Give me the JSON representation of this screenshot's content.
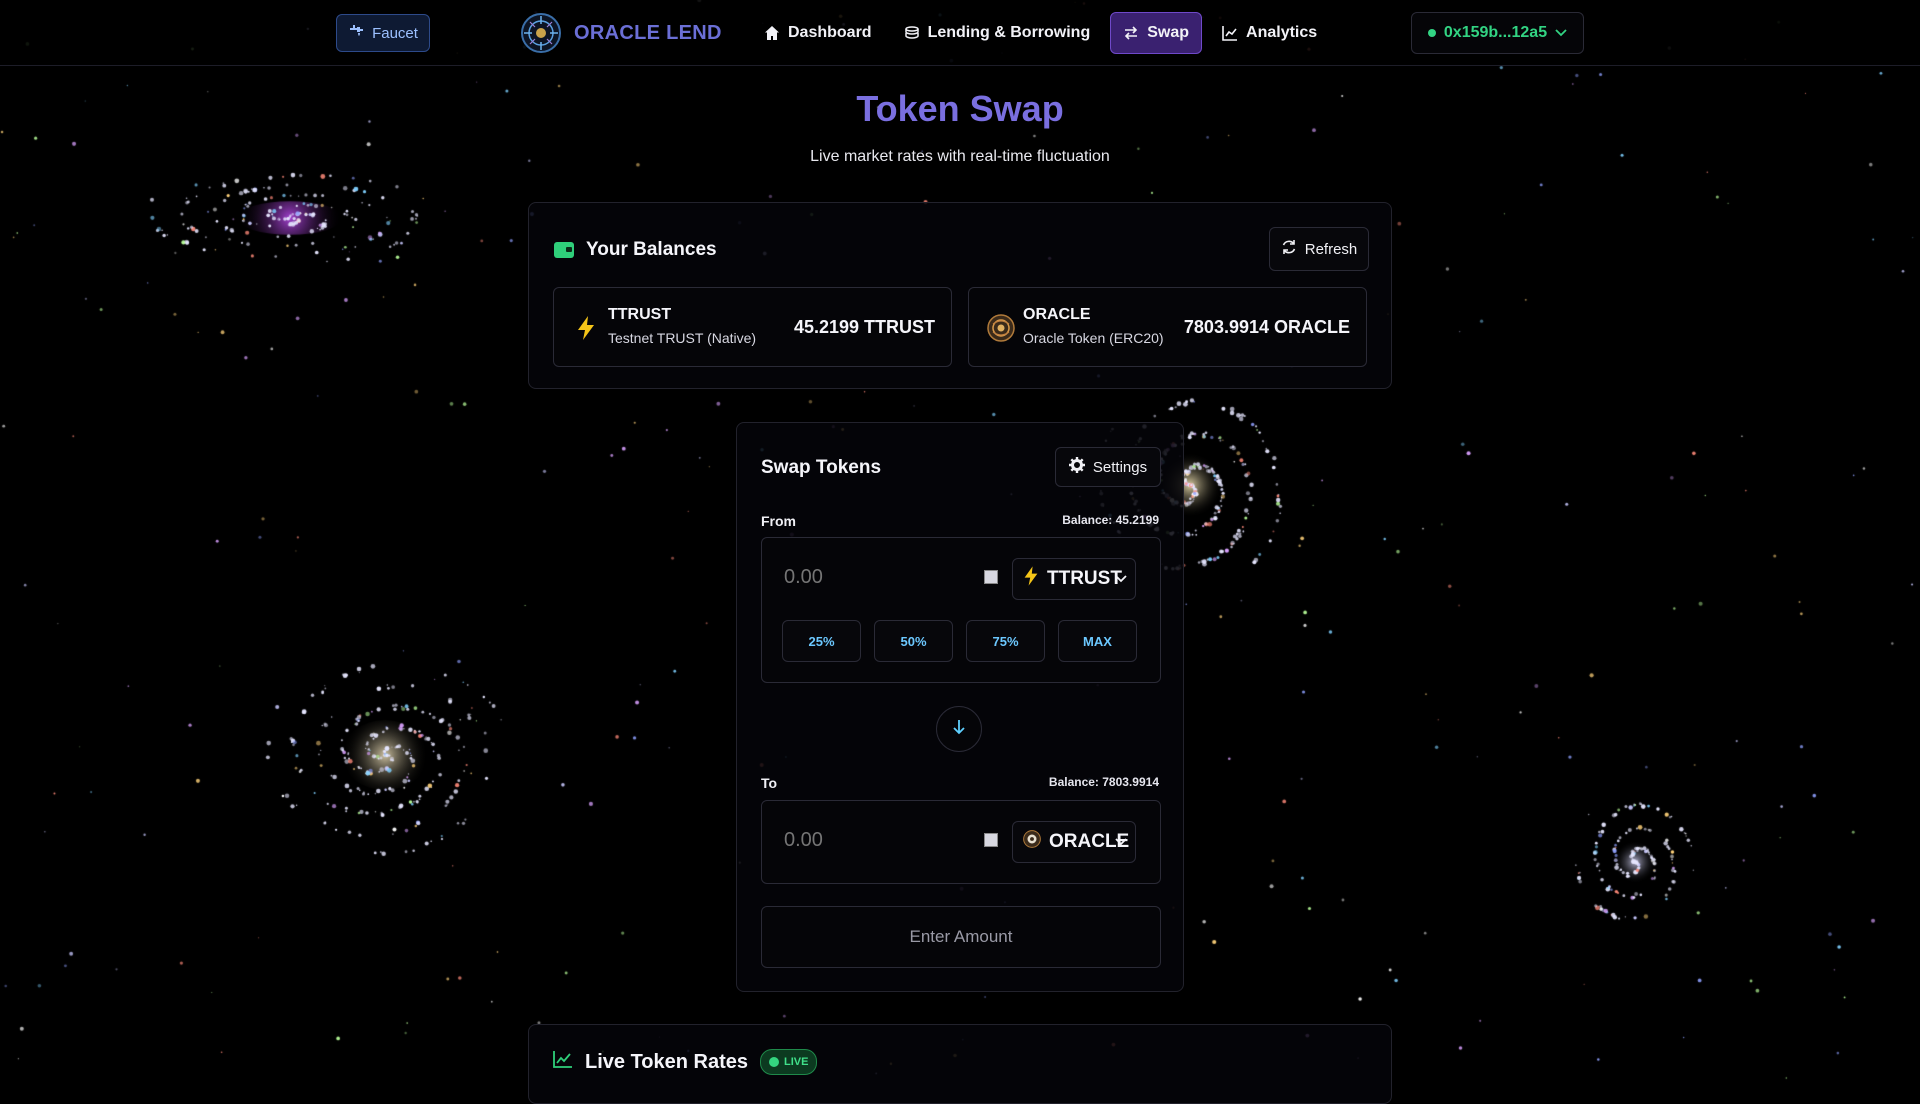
{
  "nav": {
    "faucet_label": "Faucet",
    "brand_name": "ORACLE LEND",
    "items": [
      {
        "label": "Dashboard",
        "icon": "home-icon",
        "active": false
      },
      {
        "label": "Lending & Borrowing",
        "icon": "coins-icon",
        "active": false
      },
      {
        "label": "Swap",
        "icon": "swap-icon",
        "active": true
      },
      {
        "label": "Analytics",
        "icon": "chart-icon",
        "active": false
      }
    ],
    "wallet_address": "0x159b...12a5"
  },
  "page": {
    "title": "Token Swap",
    "subtitle": "Live market rates with real-time fluctuation"
  },
  "balances": {
    "title": "Your Balances",
    "refresh_label": "Refresh",
    "tokens": [
      {
        "symbol": "TTRUST",
        "name": "Testnet TRUST (Native)",
        "amount": "45.2199 TTRUST",
        "icon": "lightning-icon"
      },
      {
        "symbol": "ORACLE",
        "name": "Oracle Token (ERC20)",
        "amount": "7803.9914 ORACLE",
        "icon": "oracle-token-icon"
      }
    ]
  },
  "swap": {
    "title": "Swap Tokens",
    "settings_label": "Settings",
    "from": {
      "label": "From",
      "balance": "Balance: 45.2199",
      "placeholder": "0.00",
      "token": "TTRUST"
    },
    "to": {
      "label": "To",
      "balance": "Balance: 7803.9914",
      "placeholder": "0.00",
      "token": "ORACLE"
    },
    "percent_buttons": [
      "25%",
      "50%",
      "75%",
      "MAX"
    ],
    "submit_label": "Enter Amount"
  },
  "rates": {
    "title": "Live Token Rates",
    "badge": "LIVE"
  },
  "colors": {
    "brand": "#6b6fd6",
    "title": "#7a6fe0",
    "active_nav": "#3a2170",
    "wallet_green": "#32d483",
    "accent_cyan": "#6cc8ff"
  }
}
